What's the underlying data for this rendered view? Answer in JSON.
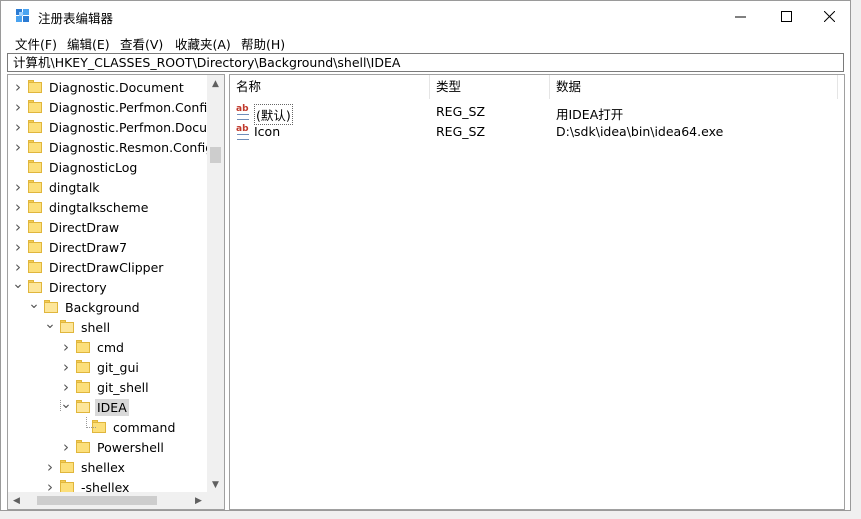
{
  "window": {
    "title": "注册表编辑器",
    "buttons": {
      "minimize": "—",
      "maximize": "☐",
      "close": "✕"
    }
  },
  "menu": [
    "文件(F)",
    "编辑(E)",
    "查看(V)",
    "收藏夹(A)",
    "帮助(H)"
  ],
  "address": "计算机\\HKEY_CLASSES_ROOT\\Directory\\Background\\shell\\IDEA",
  "tree": [
    {
      "label": "Diagnostic.Document",
      "indent": 0,
      "expander": "collapsed"
    },
    {
      "label": "Diagnostic.Perfmon.Config",
      "indent": 0,
      "expander": "collapsed"
    },
    {
      "label": "Diagnostic.Perfmon.Docum",
      "indent": 0,
      "expander": "collapsed"
    },
    {
      "label": "Diagnostic.Resmon.Config",
      "indent": 0,
      "expander": "collapsed"
    },
    {
      "label": "DiagnosticLog",
      "indent": 0,
      "expander": "none"
    },
    {
      "label": "dingtalk",
      "indent": 0,
      "expander": "collapsed"
    },
    {
      "label": "dingtalkscheme",
      "indent": 0,
      "expander": "collapsed"
    },
    {
      "label": "DirectDraw",
      "indent": 0,
      "expander": "collapsed"
    },
    {
      "label": "DirectDraw7",
      "indent": 0,
      "expander": "collapsed"
    },
    {
      "label": "DirectDrawClipper",
      "indent": 0,
      "expander": "collapsed"
    },
    {
      "label": "Directory",
      "indent": 0,
      "expander": "expanded"
    },
    {
      "label": "Background",
      "indent": 1,
      "expander": "expanded"
    },
    {
      "label": "shell",
      "indent": 2,
      "expander": "expanded"
    },
    {
      "label": "cmd",
      "indent": 3,
      "expander": "collapsed"
    },
    {
      "label": "git_gui",
      "indent": 3,
      "expander": "collapsed"
    },
    {
      "label": "git_shell",
      "indent": 3,
      "expander": "collapsed"
    },
    {
      "label": "IDEA",
      "indent": 3,
      "expander": "expanded",
      "selected": true
    },
    {
      "label": "command",
      "indent": 4,
      "expander": "none"
    },
    {
      "label": "Powershell",
      "indent": 3,
      "expander": "collapsed"
    },
    {
      "label": "shellex",
      "indent": 2,
      "expander": "collapsed"
    },
    {
      "label": "-shellex",
      "indent": 2,
      "expander": "collapsed"
    }
  ],
  "list": {
    "columns": [
      "名称",
      "类型",
      "数据"
    ],
    "rows": [
      {
        "name": "(默认)",
        "type": "REG_SZ",
        "data": "用IDEA打开",
        "icon": "string-value-icon"
      },
      {
        "name": "Icon",
        "type": "REG_SZ",
        "data": "D:\\sdk\\idea\\bin\\idea64.exe",
        "icon": "string-value-icon"
      }
    ]
  },
  "colors": {
    "folder": "#fcdf7a",
    "selection": "#d9d9d9",
    "abIcon": "#c0392b"
  }
}
